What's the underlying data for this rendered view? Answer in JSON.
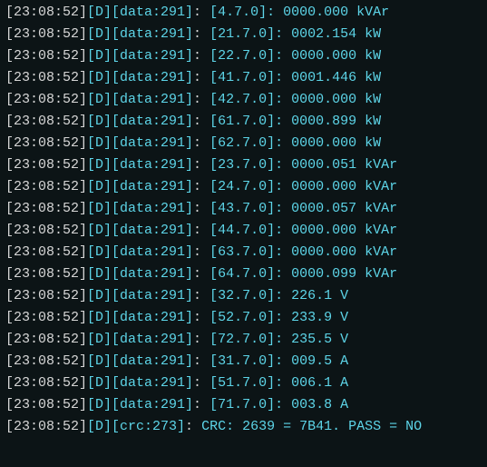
{
  "lines": [
    {
      "time": "23:08:52",
      "level": "D",
      "source": "data:291",
      "msg": "[4.7.0]: 0000.000 kVAr"
    },
    {
      "time": "23:08:52",
      "level": "D",
      "source": "data:291",
      "msg": "[21.7.0]: 0002.154 kW"
    },
    {
      "time": "23:08:52",
      "level": "D",
      "source": "data:291",
      "msg": "[22.7.0]: 0000.000 kW"
    },
    {
      "time": "23:08:52",
      "level": "D",
      "source": "data:291",
      "msg": "[41.7.0]: 0001.446 kW"
    },
    {
      "time": "23:08:52",
      "level": "D",
      "source": "data:291",
      "msg": "[42.7.0]: 0000.000 kW"
    },
    {
      "time": "23:08:52",
      "level": "D",
      "source": "data:291",
      "msg": "[61.7.0]: 0000.899 kW"
    },
    {
      "time": "23:08:52",
      "level": "D",
      "source": "data:291",
      "msg": "[62.7.0]: 0000.000 kW"
    },
    {
      "time": "23:08:52",
      "level": "D",
      "source": "data:291",
      "msg": "[23.7.0]: 0000.051 kVAr"
    },
    {
      "time": "23:08:52",
      "level": "D",
      "source": "data:291",
      "msg": "[24.7.0]: 0000.000 kVAr"
    },
    {
      "time": "23:08:52",
      "level": "D",
      "source": "data:291",
      "msg": "[43.7.0]: 0000.057 kVAr"
    },
    {
      "time": "23:08:52",
      "level": "D",
      "source": "data:291",
      "msg": "[44.7.0]: 0000.000 kVAr"
    },
    {
      "time": "23:08:52",
      "level": "D",
      "source": "data:291",
      "msg": "[63.7.0]: 0000.000 kVAr"
    },
    {
      "time": "23:08:52",
      "level": "D",
      "source": "data:291",
      "msg": "[64.7.0]: 0000.099 kVAr"
    },
    {
      "time": "23:08:52",
      "level": "D",
      "source": "data:291",
      "msg": "[32.7.0]: 226.1 V"
    },
    {
      "time": "23:08:52",
      "level": "D",
      "source": "data:291",
      "msg": "[52.7.0]: 233.9 V"
    },
    {
      "time": "23:08:52",
      "level": "D",
      "source": "data:291",
      "msg": "[72.7.0]: 235.5 V"
    },
    {
      "time": "23:08:52",
      "level": "D",
      "source": "data:291",
      "msg": "[31.7.0]: 009.5 A"
    },
    {
      "time": "23:08:52",
      "level": "D",
      "source": "data:291",
      "msg": "[51.7.0]: 006.1 A"
    },
    {
      "time": "23:08:52",
      "level": "D",
      "source": "data:291",
      "msg": "[71.7.0]: 003.8 A"
    },
    {
      "time": "23:08:52",
      "level": "D",
      "source": "crc:273",
      "msg": "CRC: 2639 = 7B41. PASS = NO"
    }
  ]
}
